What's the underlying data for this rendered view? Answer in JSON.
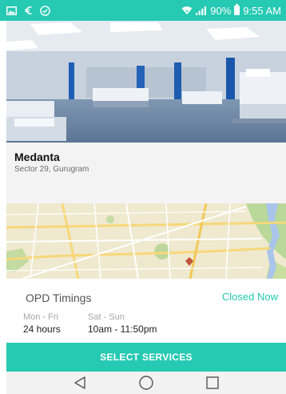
{
  "status_bar": {
    "icons_left": [
      "image-icon",
      "euro-icon",
      "check-shield-icon"
    ],
    "icons_right": [
      "wifi-icon",
      "signal-icon"
    ],
    "battery_percent": "90%",
    "time": "9:55 AM"
  },
  "hero": {
    "image": "hospital-ward-photo"
  },
  "hospital": {
    "name": "Medanta",
    "address": "Sector 29, Gurugram"
  },
  "map": {
    "image": "city-map"
  },
  "opd": {
    "title": "OPD Timings",
    "status": "Closed Now",
    "schedule": [
      {
        "days": "Mon - Fri",
        "hours": "24 hours"
      },
      {
        "days": "Sat - Sun",
        "hours": "10am - 11:50pm"
      }
    ]
  },
  "cta": {
    "label": "SELECT SERVICES"
  },
  "nav": {
    "buttons": [
      "back-icon",
      "home-icon",
      "recents-icon"
    ]
  },
  "colors": {
    "accent": "#26c9b2",
    "status_text": "#26c9b2",
    "card_bg": "#f3f3f3",
    "nav_bg": "#f2f2f2"
  }
}
